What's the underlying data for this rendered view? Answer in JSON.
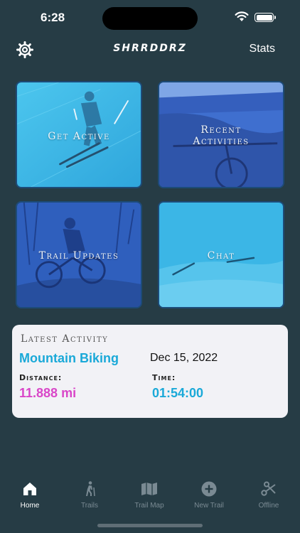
{
  "status": {
    "time": "6:28"
  },
  "header": {
    "logo": "SHRRDDRZ",
    "stats_label": "Stats"
  },
  "tiles": [
    {
      "label": "Get Active"
    },
    {
      "label_line1": "Recent",
      "label_line2": "Activities"
    },
    {
      "label": "Trail Updates"
    },
    {
      "label": "Chat"
    }
  ],
  "latest": {
    "title": "Latest Activity",
    "activity": "Mountain Biking",
    "date": "Dec 15, 2022",
    "distance_label": "Distance:",
    "distance_value": "11.888 mi",
    "time_label": "Time:",
    "time_value": "01:54:00"
  },
  "tabs": [
    {
      "label": "Home",
      "icon": "home-icon",
      "active": true
    },
    {
      "label": "Trails",
      "icon": "hiker-icon"
    },
    {
      "label": "Trail Map",
      "icon": "map-icon"
    },
    {
      "label": "New Trail",
      "icon": "plus-circle-icon"
    },
    {
      "label": "Offline",
      "icon": "scissors-icon"
    }
  ],
  "colors": {
    "background": "#263c45",
    "accent_blue": "#1aa9d8",
    "accent_pink": "#d946c8",
    "tile_cyan": "#3bb6e6"
  }
}
